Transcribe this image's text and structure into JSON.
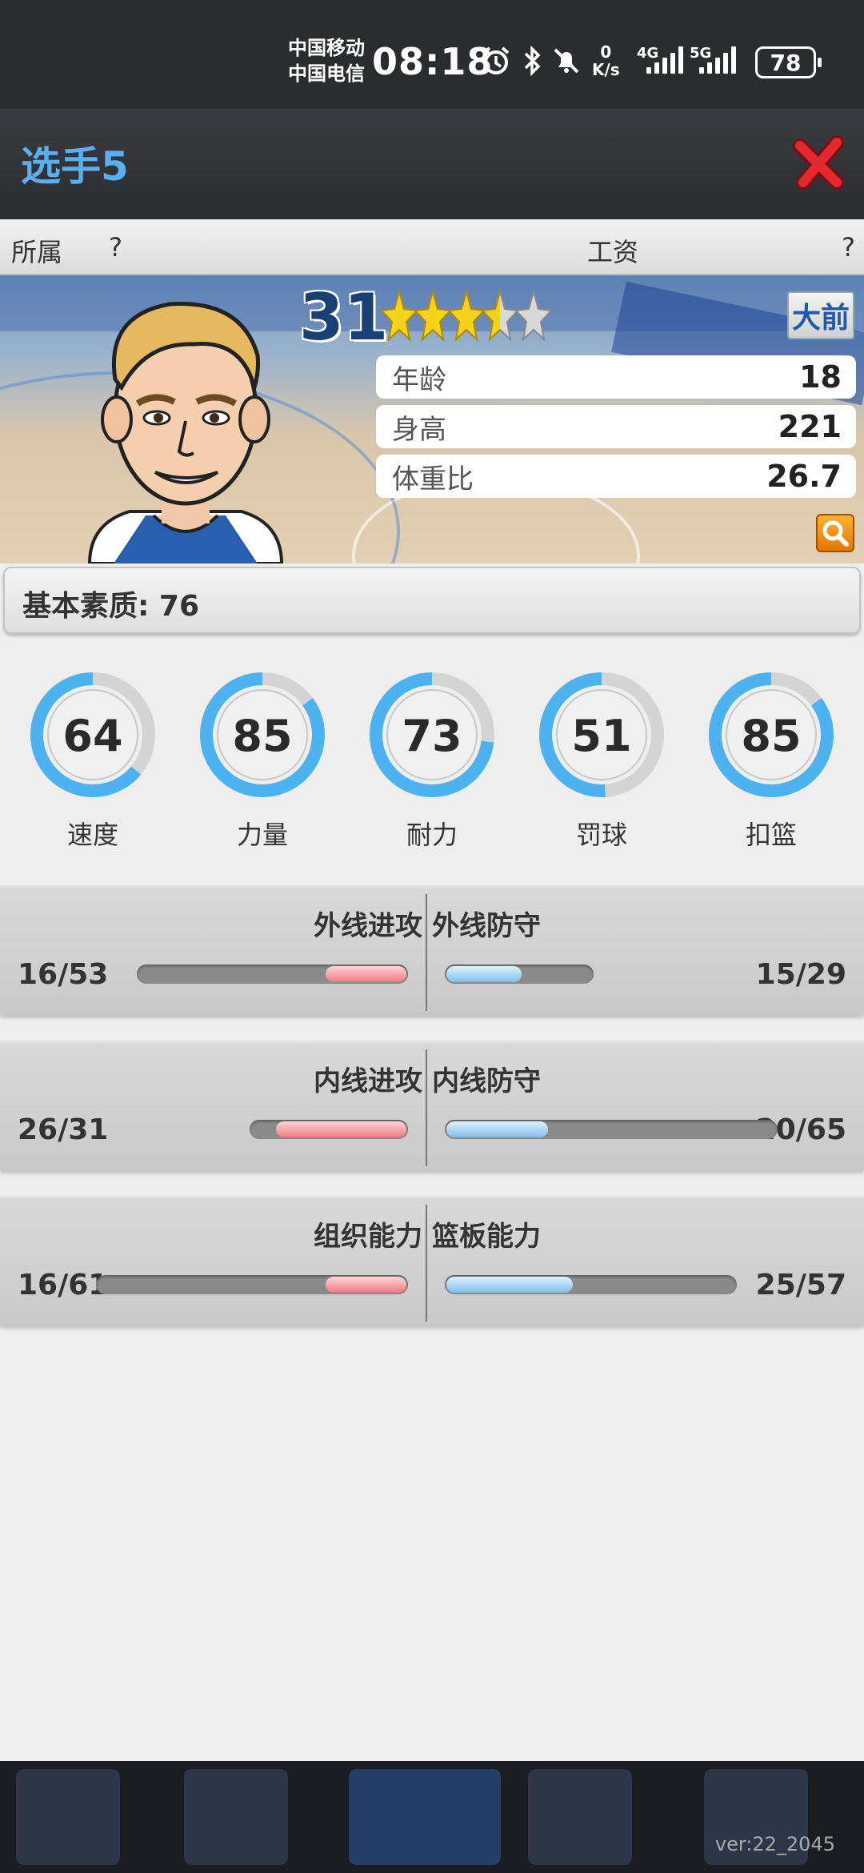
{
  "status_bar": {
    "carrier_1": "中国移动",
    "carrier_2": "中国电信",
    "time": "08:18",
    "net_speed_value": "0",
    "net_speed_unit": "K/s",
    "signal_1_label": "4G",
    "signal_2_label": "5G",
    "battery": "78",
    "icons": [
      "alarm-icon",
      "bluetooth-icon",
      "mute-icon"
    ]
  },
  "header": {
    "title": "选手5",
    "close_icon": "close-icon",
    "title_color": "#5aaff0",
    "close_color": "#d9252a"
  },
  "info_bar": {
    "team_label": "所属",
    "team_value": "?",
    "salary_label": "工资",
    "salary_value": "?"
  },
  "player": {
    "rating": "31",
    "stars": 3.5,
    "stars_max": 5,
    "position": "大前",
    "age_label": "年龄",
    "age": "18",
    "height_label": "身高",
    "height": "221",
    "weight_ratio_label": "体重比",
    "weight_ratio": "26.7",
    "search_icon": "search-icon"
  },
  "attributes": {
    "base_label": "基本素质: 76",
    "gauges": [
      {
        "name": "速度",
        "value": 64,
        "max": 100
      },
      {
        "name": "力量",
        "value": 85,
        "max": 100
      },
      {
        "name": "耐力",
        "value": 73,
        "max": 100
      },
      {
        "name": "罚球",
        "value": 51,
        "max": 100
      },
      {
        "name": "扣篮",
        "value": 85,
        "max": 100
      }
    ],
    "accent_color": "#4db3f0"
  },
  "skills": [
    {
      "left": {
        "name": "外线进攻",
        "text": "16/53",
        "current": 16,
        "max": 53
      },
      "right": {
        "name": "外线防守",
        "text": "15/29",
        "current": 15,
        "max": 29
      }
    },
    {
      "left": {
        "name": "内线进攻",
        "text": "26/31",
        "current": 26,
        "max": 31
      },
      "right": {
        "name": "内线防守",
        "text": "20/65",
        "current": 20,
        "max": 65
      }
    },
    {
      "left": {
        "name": "组织能力",
        "text": "16/61",
        "current": 16,
        "max": 61
      },
      "right": {
        "name": "篮板能力",
        "text": "25/57",
        "current": 25,
        "max": 57
      }
    }
  ],
  "footer": {
    "version": "ver:22_2045"
  }
}
